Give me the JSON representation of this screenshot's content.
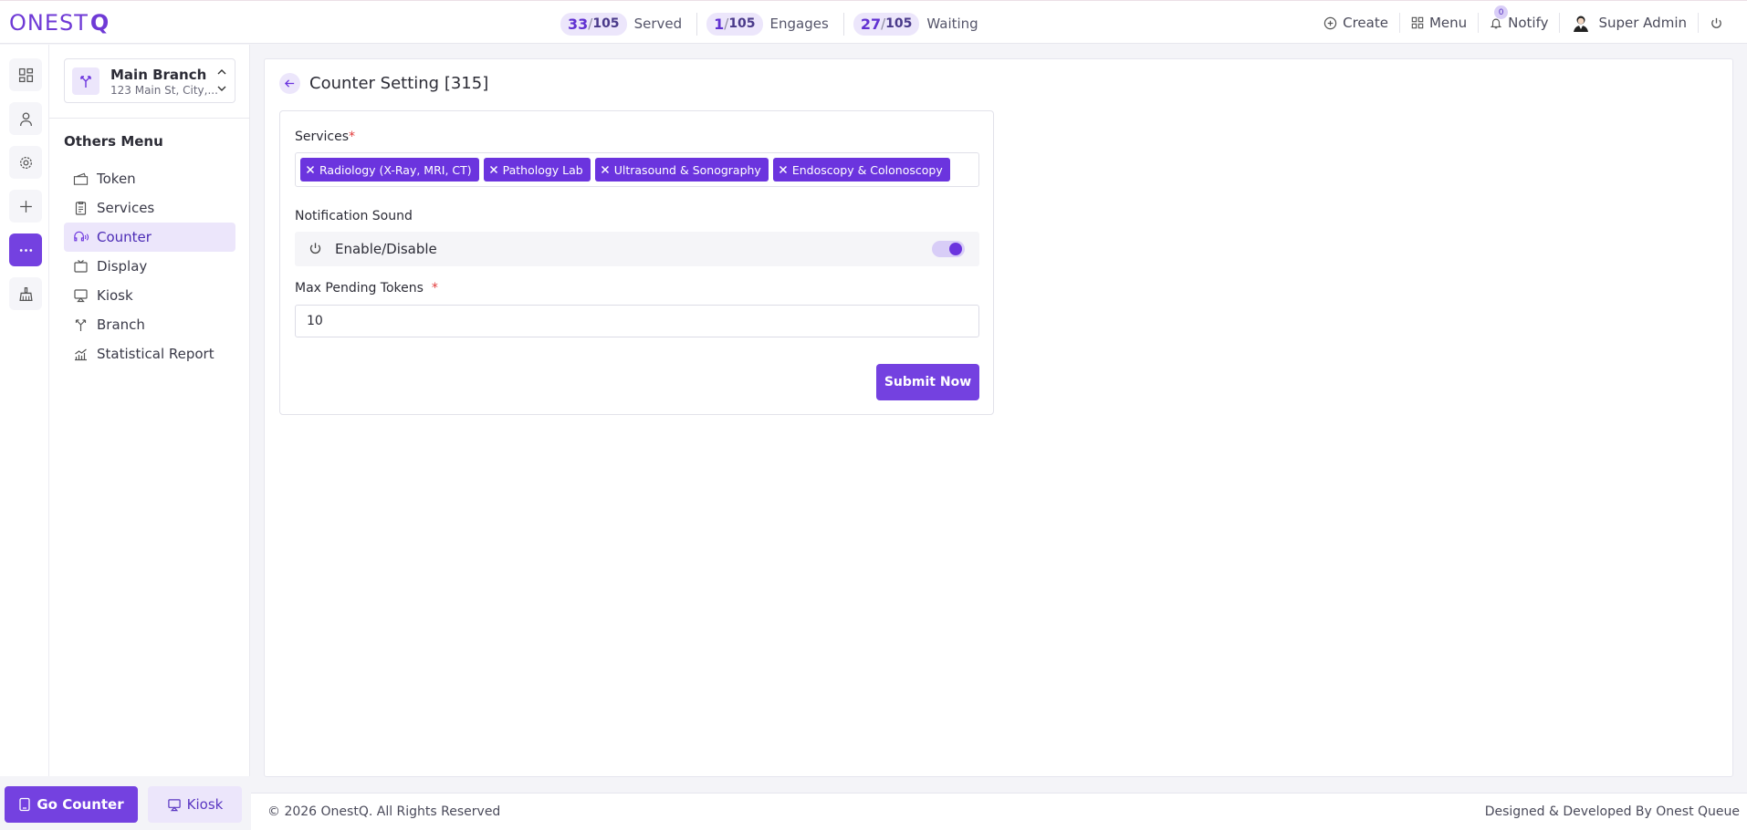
{
  "app": {
    "logo_main": "ONEST",
    "logo_q": "Q"
  },
  "stats": [
    {
      "current": "33",
      "total": "105",
      "label": "Served"
    },
    {
      "current": "1",
      "total": "105",
      "label": "Engages"
    },
    {
      "current": "27",
      "total": "105",
      "label": "Waiting"
    }
  ],
  "top_actions": {
    "create": "Create",
    "menu": "Menu",
    "notify": "Notify",
    "notify_count": "0",
    "user": "Super Admin"
  },
  "branch": {
    "name": "Main Branch",
    "address": "123 Main St, City,..."
  },
  "sidebar": {
    "title": "Others Menu",
    "items": [
      {
        "label": "Token",
        "icon": "ticket-icon"
      },
      {
        "label": "Services",
        "icon": "clipboard-icon"
      },
      {
        "label": "Counter",
        "icon": "headset-icon",
        "active": true
      },
      {
        "label": "Display",
        "icon": "tv-icon"
      },
      {
        "label": "Kiosk",
        "icon": "monitor-icon"
      },
      {
        "label": "Branch",
        "icon": "branch-icon"
      },
      {
        "label": "Statistical Report",
        "icon": "chart-icon"
      }
    ],
    "go_counter": "Go Counter",
    "kiosk": "Kiosk"
  },
  "page": {
    "title": "Counter Setting [315]",
    "services_label": "Services",
    "required_mark": "*",
    "services": [
      "Radiology (X-Ray, MRI, CT)",
      "Pathology Lab",
      "Ultrasound & Sonography",
      "Endoscopy & Colonoscopy"
    ],
    "notification_label": "Notification Sound",
    "toggle_label": "Enable/Disable",
    "toggle_on": true,
    "max_pending_label": "Max Pending Tokens",
    "max_pending_value": "10",
    "submit_label": "Submit Now"
  },
  "footer": {
    "left": "© 2026 OnestQ. All Rights Reserved",
    "right": "Designed & Developed By Onest Queue"
  },
  "colors": {
    "accent": "#7441e0",
    "accent_light": "#ece6fb",
    "required": "#e23a3a"
  }
}
